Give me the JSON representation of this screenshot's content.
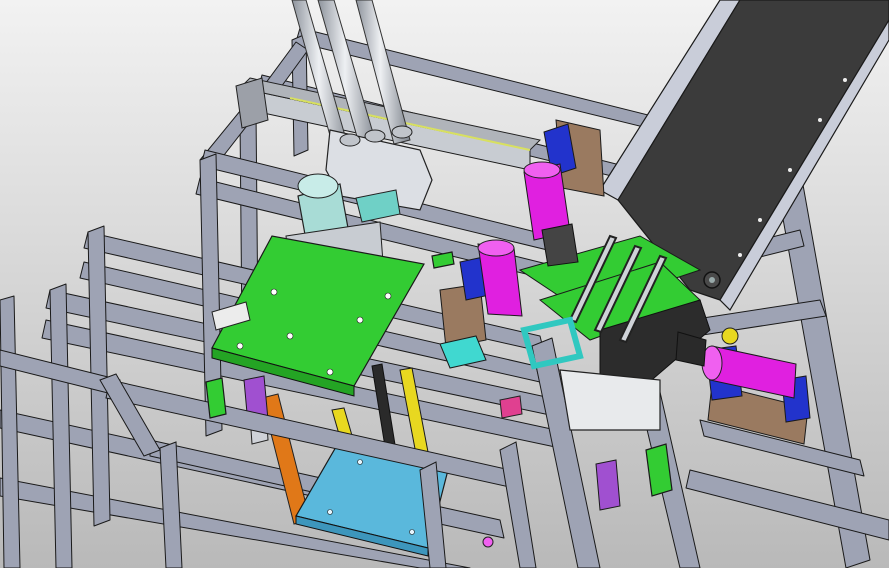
{
  "viewport": {
    "background_top": "#f2f2f2",
    "background_bottom": "#b9b9b9"
  },
  "colors": {
    "frame": "#9ea3b4",
    "frame_light": "#c9cdd9",
    "frame_dark": "#6c7183",
    "outline": "#1a1a1a",
    "conveyor_belt": "#3b3b3b",
    "top_plate": "#33cc33",
    "bottom_plate": "#5ab8dc",
    "motor_magenta": "#e020e0",
    "motor_blue": "#2233cc",
    "bracket_brown": "#9a7a60",
    "cyan_part": "#40d8d0",
    "teal_part": "#8fd6d0",
    "yellow_rod": "#e8d820",
    "orange_rail": "#e07818",
    "purple_block": "#a050d0",
    "dark_rod": "#2a2a2a",
    "steel": "#c8ccd2"
  },
  "components": [
    "aluminum-profile-frame",
    "vertical-guide-rods",
    "linear-slide-module",
    "pneumatic-cylinder",
    "lift-plate-green",
    "base-plate-blue",
    "inclined-belt-conveyor",
    "servo-motor-left",
    "servo-motor-center",
    "servo-motor-right",
    "roller-conveyor-green"
  ]
}
